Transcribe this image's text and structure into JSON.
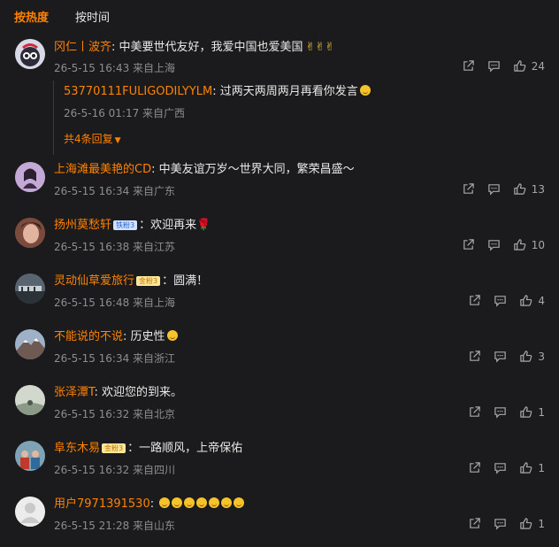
{
  "tabs": [
    {
      "label": "按热度",
      "active": true
    },
    {
      "label": "按时间",
      "active": false
    }
  ],
  "comments": [
    {
      "user": "冈仁丨波齐",
      "text": ": 中美要世代友好，我爱中国也爱美国",
      "emoji_count": 3,
      "emoji_name": "victory-hand",
      "time": "26-5-15 16:43 来自上海",
      "likes": "24"
    },
    {
      "user": "上海滩最美艳的CD",
      "text": ": 中美友谊万岁～世界大同，繁荣昌盛～",
      "time": "26-5-15 16:34 来自广东",
      "likes": "13"
    },
    {
      "user": "扬州莫愁轩",
      "badge": "铁粉3",
      "text": "：欢迎再来",
      "emoji_name": "rose",
      "time": "26-5-15 16:38 来自江苏",
      "likes": "10"
    },
    {
      "user": "灵动仙草爱旅行",
      "badge": "金粉3",
      "text": "：圆满！",
      "time": "26-5-15 16:48 来自上海",
      "likes": "4"
    },
    {
      "user": "不能说的不说",
      "text": ": 历史性",
      "emoji_name": "laugh-cry",
      "time": "26-5-15 16:34 来自浙江",
      "likes": "3"
    },
    {
      "user": "张泽潭T",
      "text": ": 欢迎您的到来。",
      "time": "26-5-15 16:32 来自北京",
      "likes": "1"
    },
    {
      "user": "阜东木易",
      "badge": "金粉3",
      "text": "：一路顺风，上帝保佑",
      "time": "26-5-15 16:32 来自四川",
      "likes": "1"
    },
    {
      "user": "用户7971391530",
      "text": ": ",
      "emoji_count": 7,
      "emoji_name": "laugh-cry",
      "time": "26-5-15 21:28 来自山东",
      "likes": "1"
    }
  ],
  "reply": {
    "user": "53770111FULIGODILYYLM",
    "text": ": 过两天两周两月再看你发言",
    "emoji_name": "face-emoji",
    "time": "26-5-16 01:17 来自广西",
    "more": "共4条回复"
  },
  "colors": {
    "accent": "#ff8200",
    "bg": "#1b1b1d",
    "text": "#e6e6e6",
    "meta": "#8d8d8d"
  }
}
